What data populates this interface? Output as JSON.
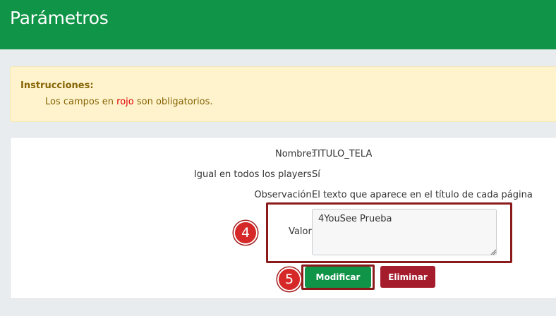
{
  "header": {
    "title": "Parámetros"
  },
  "instructions": {
    "title": "Instrucciones:",
    "msg_before": "Los campos en",
    "msg_red": "rojo",
    "msg_after": "son obligatorios."
  },
  "form": {
    "nombre_label": "Nombre:",
    "nombre_value": "TITULO_TELA",
    "igual_label": "Igual en todos los players:",
    "igual_value": "Sí",
    "obs_label": "Observación:",
    "obs_value": "El texto que aparece en el título de cada página",
    "valor_label": "Valor:",
    "valor_value": "4YouSee Prueba"
  },
  "buttons": {
    "modificar": "Modificar",
    "eliminar": "Eliminar"
  },
  "badges": {
    "valor": "4",
    "modificar": "5"
  },
  "colors": {
    "header": "#109447",
    "annotation": "#8b1a1a",
    "badge": "#d62828",
    "delete": "#a51d2d"
  }
}
